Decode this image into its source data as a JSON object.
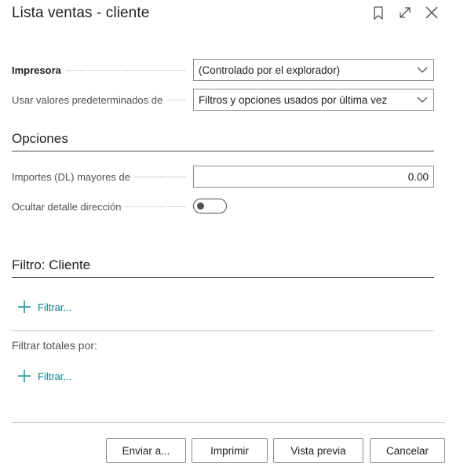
{
  "dialog": {
    "title": "Lista ventas - cliente",
    "icons": [
      "bookmark-icon",
      "expand-icon",
      "close-icon"
    ]
  },
  "printer": {
    "label": "Impresora",
    "value": "(Controlado por el explorador)"
  },
  "defaults": {
    "label": "Usar valores predeterminados de",
    "value": "Filtros y opciones usados por última vez"
  },
  "options": {
    "title": "Opciones",
    "amounts_label": "Importes (DL) mayores de",
    "amounts_value": "0.00",
    "hide_address_label": "Ocultar detalle dirección",
    "hide_address_on": false
  },
  "filter_customer": {
    "title": "Filtro: Cliente",
    "add_label": "Filtrar..."
  },
  "filter_totals": {
    "label": "Filtrar totales por:",
    "add_label": "Filtrar..."
  },
  "actions": {
    "send": "Enviar a...",
    "print": "Imprimir",
    "preview": "Vista previa",
    "cancel": "Cancelar"
  },
  "colors": {
    "accent": "#008489",
    "text": "#212121",
    "muted": "#505050",
    "border": "#8a8a8a"
  }
}
